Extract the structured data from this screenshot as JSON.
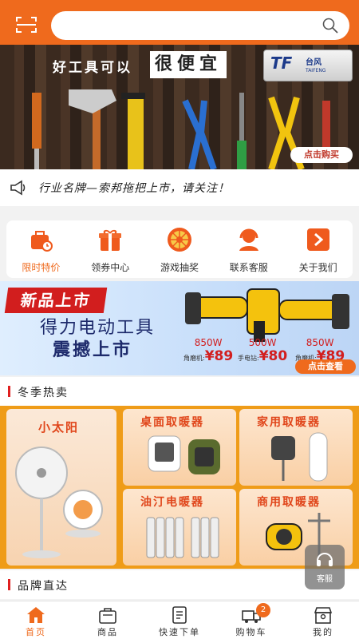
{
  "colors": {
    "accent": "#ef6a1d",
    "badge_red": "#d21e1e",
    "grid_bg": "#ef9c18"
  },
  "search": {
    "value": "",
    "placeholder": ""
  },
  "hero": {
    "slogan_left": "好工具可以",
    "slogan_right": "很便宜",
    "brand_mark": "TF",
    "brand_cn": "台风",
    "brand_en": "TAIFENG",
    "button": "点击购买"
  },
  "notice": {
    "icon": "speaker-icon",
    "text": "行业名牌—索邦拖把上市，请关注！"
  },
  "nav": [
    {
      "label": "限时特价",
      "icon": "clock-bag-icon",
      "active": true
    },
    {
      "label": "领券中心",
      "icon": "gift-icon",
      "active": false
    },
    {
      "label": "游戏抽奖",
      "icon": "lottery-wheel-icon",
      "active": false
    },
    {
      "label": "联系客服",
      "icon": "customer-service-icon",
      "active": false
    },
    {
      "label": "关于我们",
      "icon": "arrow-right-icon",
      "active": false
    }
  ],
  "promo": {
    "tag": "新品上市",
    "line1": "得力电动工具",
    "line2": "震撼上市",
    "prices": [
      {
        "watt": "850W",
        "label": "角磨机:",
        "price": "¥89"
      },
      {
        "watt": "500W",
        "label": "手电钻:",
        "price": "¥80"
      },
      {
        "watt": "850W",
        "label": "角磨机:",
        "price": "¥89"
      }
    ],
    "button": "点击查看"
  },
  "section_winter": {
    "title": "冬季热卖"
  },
  "products": [
    {
      "title": "小太阳"
    },
    {
      "title": "桌面取暖器"
    },
    {
      "title": "家用取暖器"
    },
    {
      "title": "油汀电暖器"
    },
    {
      "title": "商用取暖器"
    }
  ],
  "section_brand": {
    "title": "品牌直达"
  },
  "service": {
    "label": "客服"
  },
  "tabs": [
    {
      "label": "首页",
      "icon": "home-icon",
      "active": true
    },
    {
      "label": "商品",
      "icon": "shopping-bag-icon",
      "active": false
    },
    {
      "label": "快速下单",
      "icon": "order-list-icon",
      "active": false
    },
    {
      "label": "购物车",
      "icon": "delivery-truck-icon",
      "active": false,
      "badge": "2"
    },
    {
      "label": "我的",
      "icon": "store-user-icon",
      "active": false
    }
  ]
}
